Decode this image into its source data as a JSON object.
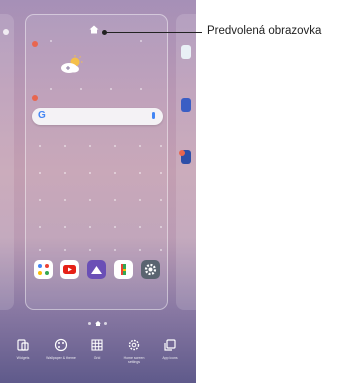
{
  "callout": {
    "label": "Predvolená obrazovka"
  },
  "search": {
    "logo": "G"
  },
  "apps": [
    {
      "name": "Google",
      "color": "#ffffff"
    },
    {
      "name": "YouTube",
      "color": "#ffffff"
    },
    {
      "name": "Gallery",
      "color": "#6a4fb6"
    },
    {
      "name": "Google Play",
      "color": "#ffffff"
    },
    {
      "name": "Settings",
      "color": "#5a6470"
    }
  ],
  "toolbar": [
    {
      "label": "Widgets",
      "icon": "widgets-icon"
    },
    {
      "label": "Wallpaper & theme",
      "icon": "palette-icon"
    },
    {
      "label": "Grid",
      "icon": "grid-icon"
    },
    {
      "label": "Home screen settings",
      "icon": "gear-icon"
    },
    {
      "label": "App icons",
      "icon": "app-icons-icon"
    }
  ],
  "colors": {
    "remove_badge": "#e8664f",
    "search_accent": "#4285f4"
  }
}
